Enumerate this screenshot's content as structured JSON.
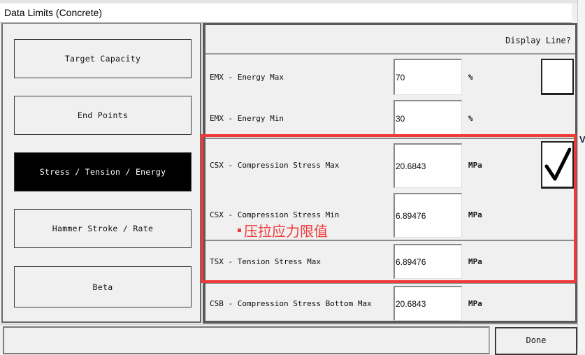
{
  "window": {
    "title": "Data Limits (Concrete)"
  },
  "sidebar": {
    "items": [
      {
        "label": "Target Capacity",
        "active": false
      },
      {
        "label": "End Points",
        "active": false
      },
      {
        "label": "Stress / Tension / Energy",
        "active": true
      },
      {
        "label": "Hammer Stroke / Rate",
        "active": false
      },
      {
        "label": "Beta",
        "active": false
      }
    ]
  },
  "panel": {
    "display_line_header": "Display Line?",
    "rows": [
      {
        "label": "EMX - Energy Max",
        "value": "70",
        "unit": "%"
      },
      {
        "label": "EMX - Energy Min",
        "value": "30",
        "unit": "%"
      },
      {
        "label": "CSX - Compression Stress Max",
        "value": "20.6843",
        "unit": "MPa"
      },
      {
        "label": "CSX - Compression Stress Min",
        "value": "6.89476",
        "unit": "MPa"
      },
      {
        "label": "TSX - Tension Stress Max",
        "value": "6.89476",
        "unit": "MPa"
      },
      {
        "label": "CSB - Compression Stress Bottom Max",
        "value": "20.6843",
        "unit": "MPa"
      }
    ],
    "display_line_checkboxes": [
      {
        "group": "EMX",
        "checked": false
      },
      {
        "group": "CSX",
        "checked": true
      }
    ]
  },
  "annotation": {
    "text": "压拉应力限值",
    "color": "#f03a3a"
  },
  "footer": {
    "done_label": "Done"
  },
  "background_window": {
    "edge_letter": "V"
  }
}
